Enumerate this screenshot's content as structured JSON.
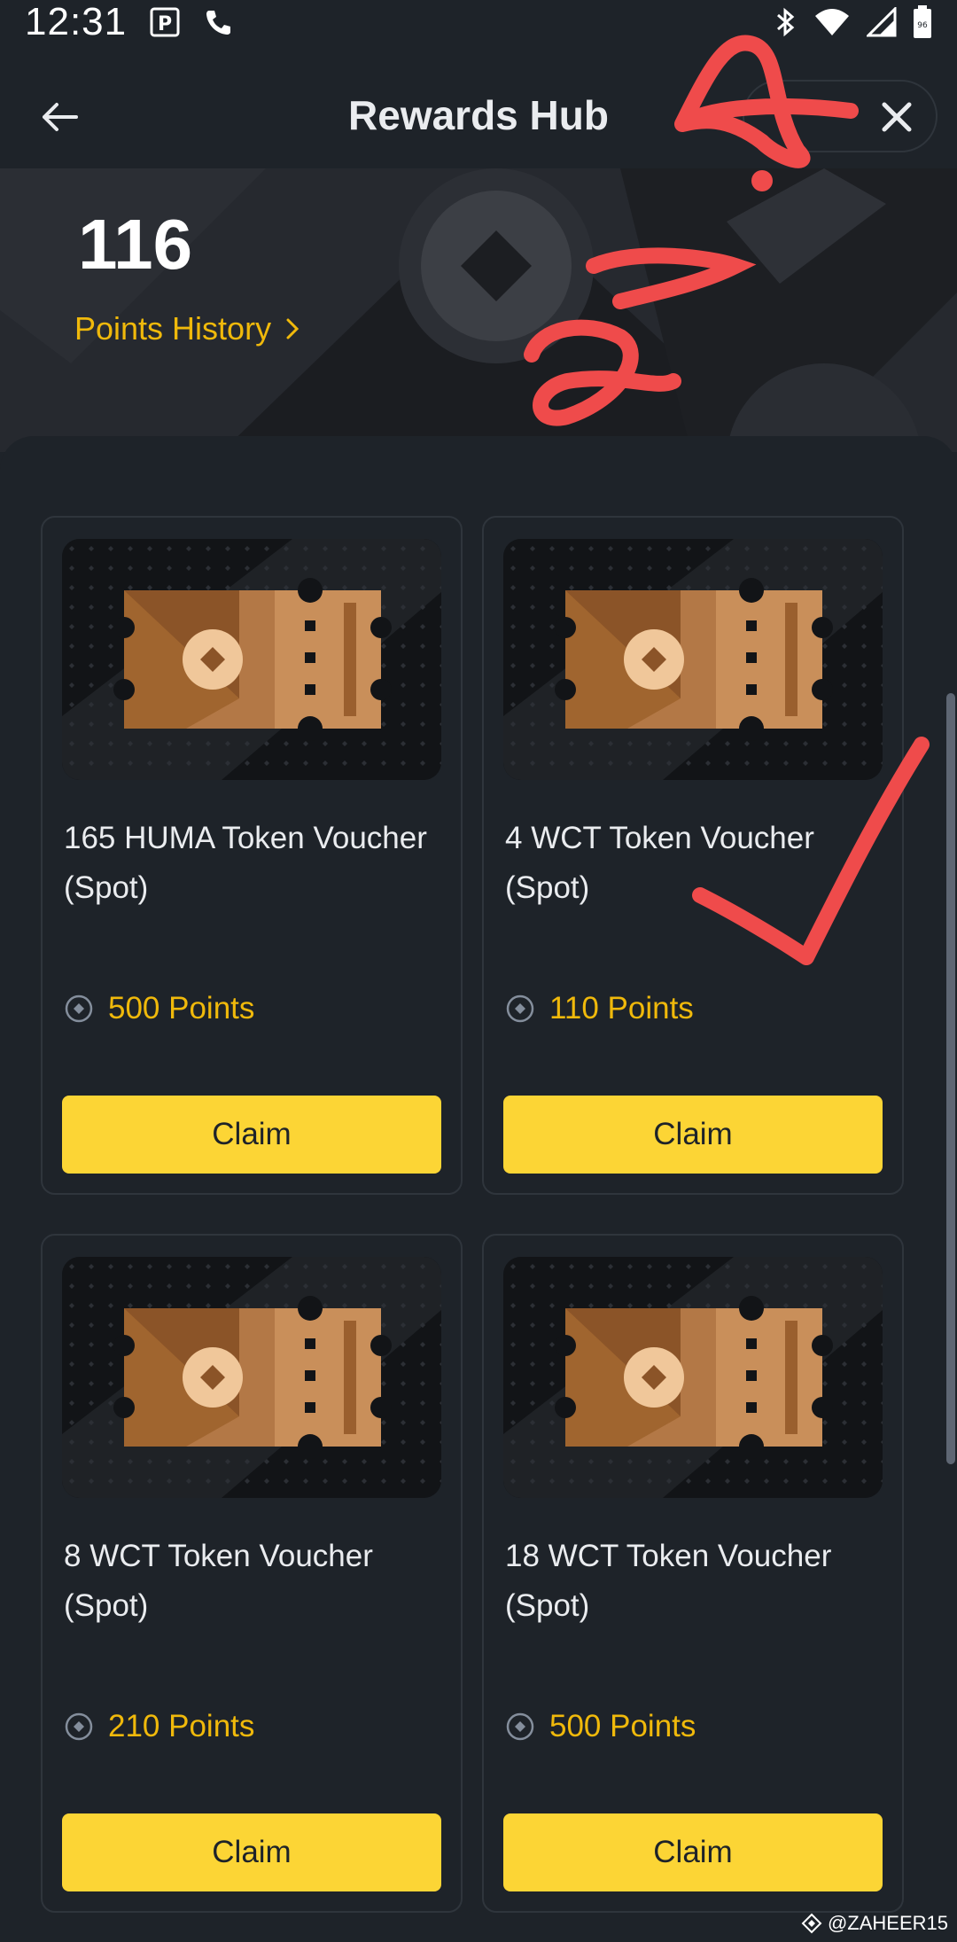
{
  "status_bar": {
    "time": "12:31",
    "battery": "96",
    "icons": [
      "parking-icon",
      "phone-icon",
      "bluetooth-icon",
      "wifi-icon",
      "signal-icon",
      "battery-icon"
    ]
  },
  "header": {
    "title": "Rewards Hub",
    "back_icon": "arrow-left-icon",
    "close_icon": "close-icon"
  },
  "banner": {
    "points": "116",
    "history_label": "Points History",
    "history_icon": "chevron-right-icon"
  },
  "vouchers": [
    {
      "title": "165 HUMA Token Voucher (Spot)",
      "points": "500 Points",
      "claim_label": "Claim"
    },
    {
      "title": "4 WCT Token Voucher (Spot)",
      "points": "110 Points",
      "claim_label": "Claim"
    },
    {
      "title": "8 WCT Token Voucher (Spot)",
      "points": "210 Points",
      "claim_label": "Claim"
    },
    {
      "title": "18 WCT Token Voucher (Spot)",
      "points": "500 Points",
      "claim_label": "Claim"
    }
  ],
  "watermark": "@ZAHEER15",
  "colors": {
    "background": "#1e2329",
    "accent_yellow": "#f0b90b",
    "button_yellow": "#fcd535",
    "annotation_red": "#ef4b4b"
  }
}
